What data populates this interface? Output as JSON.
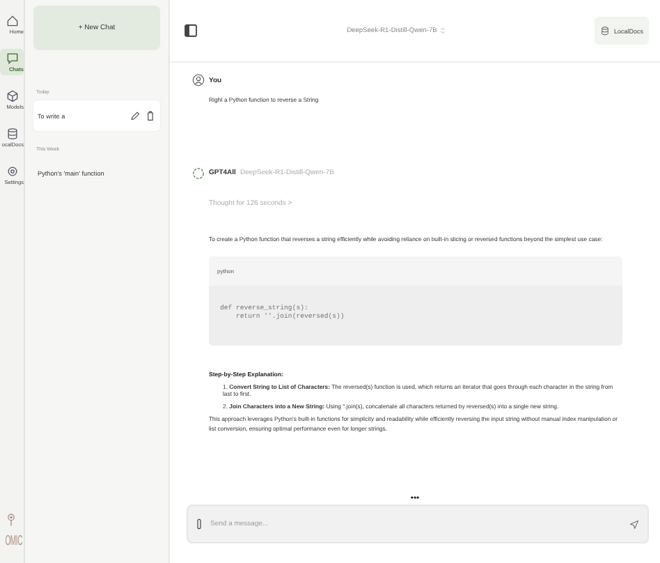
{
  "rail": {
    "items": [
      {
        "label": "Home",
        "kind": "home",
        "selected": false
      },
      {
        "label": "Chats",
        "kind": "chat",
        "selected": true
      },
      {
        "label": "Models",
        "kind": "cube",
        "selected": false
      },
      {
        "label": "ocalDocs",
        "kind": "db",
        "selected": false
      },
      {
        "label": "Settings",
        "kind": "gear",
        "selected": false
      }
    ],
    "logo": "OMIC"
  },
  "sidebar": {
    "new_chat": "+ New Chat",
    "groups": [
      {
        "label": "Today",
        "items": [
          {
            "title": "To write a",
            "selected": true
          }
        ]
      },
      {
        "label": "This Week",
        "items": [
          {
            "title": "Python's 'main' function",
            "selected": false
          }
        ]
      }
    ]
  },
  "header": {
    "model": "DeepSeek-R1-Distill-Qwen-7B",
    "localdocs": "LocalDocs"
  },
  "messages": [
    {
      "kind": "user",
      "author": "You",
      "text": "Right a Python function to reverse a String"
    },
    {
      "kind": "assistant",
      "author": "GPT4All",
      "model": "DeepSeek-R1-Distill-Qwen-7B",
      "thought": "Thought for 126 seconds",
      "caret": ">",
      "intro": "To create a Python function that reverses a string efficiently while avoiding reliance on built-in slicing or reversed functions beyond the simplest use case:",
      "code_lang": "python",
      "code": [
        "def reverse_string(s):",
        "    return ''.join(reversed(s))"
      ],
      "steps_title": "Step-by-Step Explanation:",
      "steps": [
        "1. **Convert String to List of Characters:** The reversed(s) function is used, which returns an iterator that goes through each character in the string from last to first.",
        "2. **Join Characters into a New String:** Using ''.join(s), concatenate all characters returned by reversed(s) into a single new string."
      ],
      "outro": "This approach leverages Python's built-in functions for simplicity and readability while efficiently reversing the input string without manual index manipulation or list conversion, ensuring optimal performance even for longer strings."
    }
  ],
  "more": "•••",
  "input": {
    "placeholder": "Send a message..."
  }
}
